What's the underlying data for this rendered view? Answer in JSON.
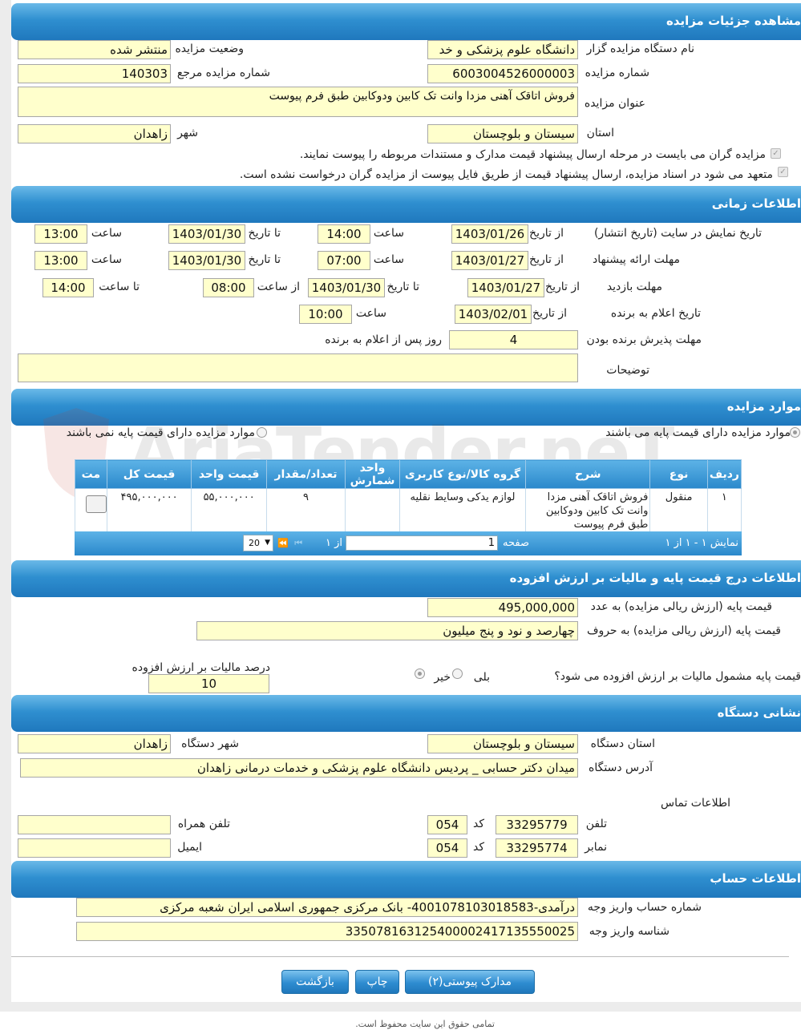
{
  "sections": {
    "details": "مشاهده جزئیات مزایده",
    "timing": "اطلاعات زمانی",
    "items": "موارد مزایده",
    "base_price": "اطلاعات درج قیمت پایه و مالیات بر ارزش افزوده",
    "address": "نشانی دستگاه",
    "account": "اطلاعات حساب"
  },
  "details": {
    "org_name_label": "نام دستگاه مزایده گزار",
    "org_name": "دانشگاه علوم پزشکی و خد",
    "status_label": "وضعیت مزایده",
    "status": "منتشر شده",
    "auction_no_label": "شماره مزایده",
    "auction_no": "6003004526000003",
    "ref_no_label": "شماره مزایده مرجع",
    "ref_no": "140303",
    "title_label": "عنوان مزایده",
    "title": "فروش اتاقک آهنی مزدا وانت تک کابین ودوکابین طبق فرم پیوست",
    "province_label": "استان",
    "province": "سیستان و بلوچستان",
    "city_label": "شهر",
    "city": "زاهدان",
    "check1": "مزایده گران می بایست در مرحله ارسال پیشنهاد قیمت مدارک و مستندات مربوطه را پیوست نمایند.",
    "check2": "متعهد می شود در اسناد مزایده، ارسال پیشنهاد قیمت از طریق فایل پیوست از مزایده گران درخواست نشده است."
  },
  "timing": {
    "display_label": "تاریخ نمایش در سایت (تاریخ انتشار)",
    "offer_label": "مهلت ارائه پیشنهاد",
    "visit_label": "مهلت بازدید",
    "winner_label": "تاریخ اعلام به برنده",
    "accept_label": "مهلت پذیرش برنده بودن",
    "desc_label": "توضیحات",
    "from_date": "از تاریخ",
    "to_date": "تا تاریخ",
    "time": "ساعت",
    "from_time": "از ساعت",
    "to_time": "تا ساعت",
    "days_after": "روز پس از اعلام به برنده",
    "display_from": "1403/01/26",
    "display_from_time": "14:00",
    "display_to": "1403/01/30",
    "display_to_time": "13:00",
    "offer_from": "1403/01/27",
    "offer_from_time": "07:00",
    "offer_to": "1403/01/30",
    "offer_to_time": "13:00",
    "visit_from": "1403/01/27",
    "visit_to": "1403/01/30",
    "visit_from_time": "08:00",
    "visit_to_time": "14:00",
    "winner_from": "1403/02/01",
    "winner_time": "10:00",
    "accept_days": "4",
    "description": ""
  },
  "items": {
    "radio_with": "موارد مزایده دارای قیمت پایه می باشند",
    "radio_without": "موارد مزایده دارای قیمت پایه نمی باشند",
    "columns": [
      "ردیف",
      "نوع",
      "شرح",
      "گروه کالا/نوع کاربری",
      "واحد شمارش",
      "تعداد/مقدار",
      "قیمت واحد",
      "قیمت کل",
      "مت"
    ],
    "rows": [
      {
        "row": "۱",
        "type": "منقول",
        "desc": "فروش اتاقک آهنی مزدا وانت تک کابین ودوکابین طبق فرم پیوست",
        "group": "لوازم یدکی وسایط نقلیه",
        "unit": "",
        "qty": "۹",
        "unit_price": "۵۵,۰۰۰,۰۰۰",
        "total": "۴۹۵,۰۰۰,۰۰۰"
      }
    ],
    "pager_summary": "نمایش ۱ - ۱ از ۱",
    "page_label": "صفحه",
    "page_value": "1",
    "of_label": "از ۱",
    "page_size": "20"
  },
  "base_price": {
    "numeric_label": "قیمت پایه (ارزش ریالی مزایده) به عدد",
    "numeric": "495,000,000",
    "words_label": "قیمت پایه (ارزش ریالی مزایده) به حروف",
    "words": "چهارصد و نود و پنج میلیون",
    "vat_question": "قیمت پایه مشمول مالیات بر ارزش افزوده می شود؟",
    "yes": "بلی",
    "no": "خیر",
    "vat_percent_label": "درصد مالیات بر ارزش افزوده",
    "vat_percent": "10"
  },
  "address": {
    "province_label": "استان دستگاه",
    "province": "سیستان و بلوچستان",
    "city_label": "شهر دستگاه",
    "city": "زاهدان",
    "address_label": "آدرس دستگاه",
    "address": "میدان دکتر حسابی _ پردیس دانشگاه علوم پزشکی و خدمات درمانی زاهدان",
    "contact_label": "اطلاعات تماس",
    "phone_label": "تلفن",
    "phone": "33295779",
    "code_label": "کد",
    "phone_code": "054",
    "fax_label": "نمابر",
    "fax": "33295774",
    "fax_code": "054",
    "mobile_label": "تلفن همراه",
    "mobile": "",
    "email_label": "ایمیل",
    "email": ""
  },
  "account": {
    "account_label": "شماره حساب واریز وجه",
    "account": "درآمدی-4001078103018583- بانک مرکزی جمهوری اسلامی ایران شعبه مرکزی",
    "shaba_label": "شناسه واریز وجه",
    "shaba": "335078163125400002417135550025"
  },
  "buttons": {
    "attachments": "مدارک پیوستی(۲)",
    "print": "چاپ",
    "back": "بازگشت"
  },
  "footer": "تمامی حقوق این سایت محفوظ است.",
  "watermark": "AriaTender.neT"
}
